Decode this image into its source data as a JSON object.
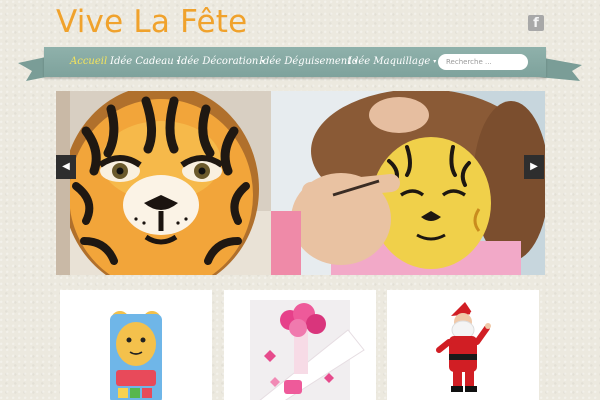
{
  "site": {
    "title": "Vive La Fête"
  },
  "social": {
    "facebook_label": "f"
  },
  "nav": {
    "items": [
      {
        "label": "Accueil",
        "active": true,
        "dropdown": false
      },
      {
        "label": "Idée Cadeau",
        "active": false,
        "dropdown": true
      },
      {
        "label": "Idée Décoration",
        "active": false,
        "dropdown": true
      },
      {
        "label": "Idée Déguisement",
        "active": false,
        "dropdown": true
      },
      {
        "label": "Idée Maquillage",
        "active": false,
        "dropdown": true
      }
    ],
    "caret": "▾"
  },
  "search": {
    "placeholder": "Recherche ..."
  },
  "slider": {
    "prev_label": "◀",
    "next_label": "▶"
  },
  "colors": {
    "title": "#f0a22c",
    "nav_bg": "#8fb1ab",
    "nav_active": "#f4e45c",
    "page_bg": "#ece9df"
  },
  "icons": [
    "facebook-icon",
    "search-field",
    "prev-arrow-icon",
    "next-arrow-icon"
  ]
}
